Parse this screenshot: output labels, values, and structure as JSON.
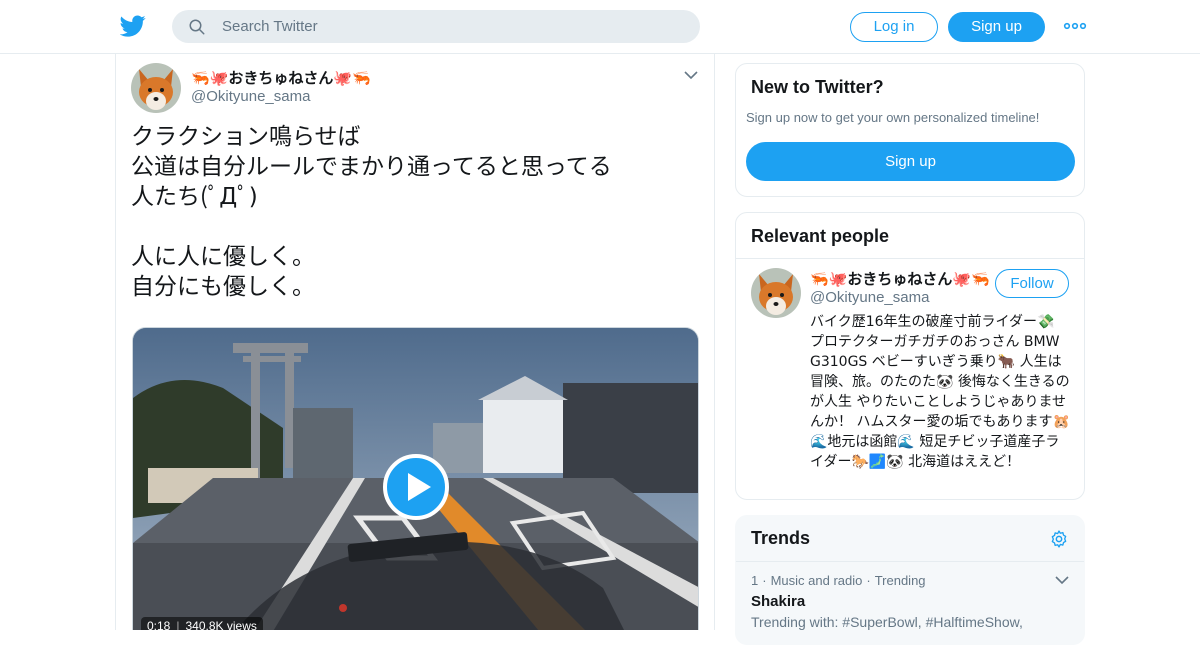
{
  "header": {
    "logo_icon": "twitter-bird-icon",
    "search_placeholder": "Search Twitter",
    "login_label": "Log in",
    "signup_label": "Sign up",
    "more_icon": "more-dots-icon"
  },
  "tweet": {
    "author_name": "🦐🐙おきちゅねさん🐙🦐",
    "author_handle": "@Okityune_sama",
    "text": "クラクション鳴らせば\n公道は自分ルールでまかり通ってると思ってる\n人たち(ﾟДﾟ)\n\n人に人に優しく。\n自分にも優しく。",
    "video": {
      "duration": "0:18",
      "views": "340.8K views"
    }
  },
  "sidebar": {
    "new_to_twitter": {
      "title": "New to Twitter?",
      "subtitle": "Sign up now to get your own personalized timeline!",
      "button_label": "Sign up"
    },
    "relevant_people": {
      "title": "Relevant people",
      "person": {
        "name": "🦐🐙おきちゅねさん🐙🦐",
        "handle": "@Okityune_sama",
        "follow_label": "Follow",
        "bio": "バイク歴16年生の破産寸前ライダー💸 プロテクターガチガチのおっさん BMW G310GS ベビーすいぎう乗り🐂 人生は冒険、旅。のたのた🐼 後悔なく生きるのが人生 やりたいことしようじゃありませんか！ ハムスター愛の垢でもあります🐹 🌊地元は函館🌊 短足チビッ子道産子ライダー🐎🗾🐼 北海道はええど！"
      }
    },
    "trends": {
      "title": "Trends",
      "items": [
        {
          "rank": "1",
          "category": "Music and radio",
          "status": "Trending",
          "name": "Shakira",
          "description": "Trending with: #SuperBowl, #HalftimeShow,"
        }
      ]
    }
  },
  "colors": {
    "brand_blue": "#1da1f2",
    "secondary_text": "#657786",
    "border": "#e6ecf0"
  }
}
